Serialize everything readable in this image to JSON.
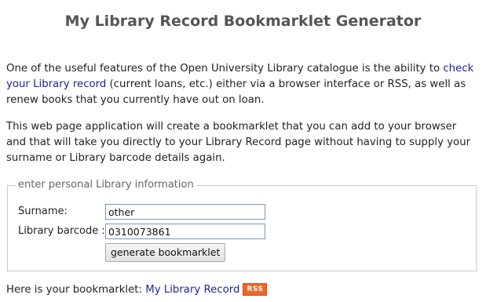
{
  "page": {
    "title": "My Library Record Bookmarklet Generator"
  },
  "intro": {
    "text_before_link": "One of the useful features of the Open University Library catalogue is the ability to ",
    "link_text": "check your Library record",
    "text_after_link": " (current loans, etc.) either via a browser interface or RSS, as well as renew books that you currently have out on loan."
  },
  "description": {
    "text": "This web page application will create a bookmarklet that you can add to your browser and that will take you directly to your Library Record page without having to supply your surname or Library barcode details again."
  },
  "form": {
    "legend": "enter personal Library information",
    "surname_label": "Surname:",
    "surname_value": "other",
    "barcode_label": "Library barcode :",
    "barcode_value": "0310073861",
    "submit_label": "generate bookmarklet"
  },
  "result": {
    "prefix": "Here is your bookmarklet: ",
    "bookmarklet_link": "My Library Record",
    "rss_badge": "RSS",
    "rss_icon": "rss-icon"
  },
  "colors": {
    "link": "#1f1f99",
    "title": "#555555",
    "rss": "#f26522"
  }
}
